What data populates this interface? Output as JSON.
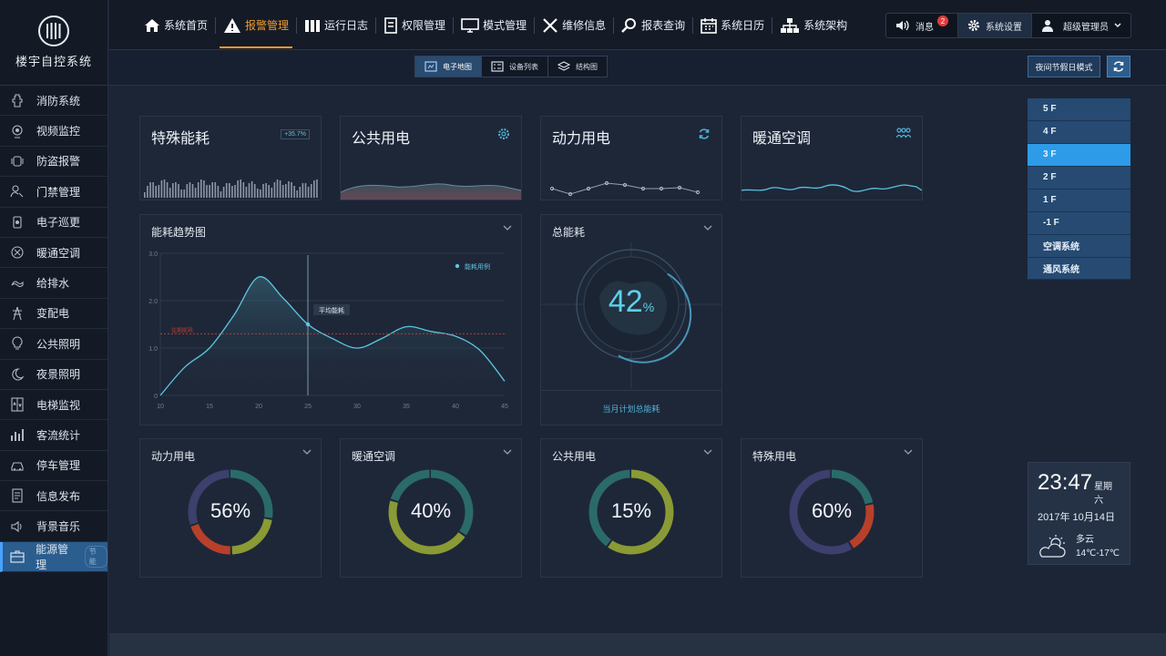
{
  "app": {
    "title": "楼宇自控系统"
  },
  "sidebar": {
    "items": [
      {
        "label": "消防系统",
        "icon": "fire-hydrant-icon"
      },
      {
        "label": "视频监控",
        "icon": "camera-icon"
      },
      {
        "label": "防盗报警",
        "icon": "alarm-icon"
      },
      {
        "label": "门禁管理",
        "icon": "access-control-icon"
      },
      {
        "label": "电子巡更",
        "icon": "patrol-icon"
      },
      {
        "label": "暖通空调",
        "icon": "hvac-icon"
      },
      {
        "label": "给排水",
        "icon": "water-icon"
      },
      {
        "label": "变配电",
        "icon": "power-tower-icon"
      },
      {
        "label": "公共照明",
        "icon": "bulb-icon"
      },
      {
        "label": "夜景照明",
        "icon": "night-light-icon"
      },
      {
        "label": "电梯监视",
        "icon": "elevator-icon"
      },
      {
        "label": "客流统计",
        "icon": "bar-stats-icon"
      },
      {
        "label": "停车管理",
        "icon": "car-icon"
      },
      {
        "label": "信息发布",
        "icon": "document-icon"
      },
      {
        "label": "背景音乐",
        "icon": "speaker-icon"
      },
      {
        "label": "能源管理",
        "icon": "briefcase-icon",
        "badge": "节能",
        "active": true
      }
    ]
  },
  "nav": {
    "items": [
      {
        "label": "系统首页",
        "icon": "home-icon"
      },
      {
        "label": "报警管理",
        "icon": "warning-icon",
        "active": true
      },
      {
        "label": "运行日志",
        "icon": "log-icon"
      },
      {
        "label": "权限管理",
        "icon": "permission-icon"
      },
      {
        "label": "模式管理",
        "icon": "monitor-icon"
      },
      {
        "label": "维修信息",
        "icon": "tools-icon"
      },
      {
        "label": "报表查询",
        "icon": "search-icon"
      },
      {
        "label": "系统日历",
        "icon": "calendar-icon"
      },
      {
        "label": "系统架构",
        "icon": "org-chart-icon"
      }
    ]
  },
  "user": {
    "messages_label": "消息",
    "message_count": "2",
    "settings_label": "系统设置",
    "user_name": "超级管理员"
  },
  "subbar": {
    "views": [
      {
        "label": "电子地图",
        "active": true
      },
      {
        "label": "设备列表"
      },
      {
        "label": "结构图"
      }
    ],
    "holiday_button": "夜间节假日模式"
  },
  "summary_cards": [
    {
      "title": "特殊能耗",
      "tag": "+35.7%",
      "icon": "none"
    },
    {
      "title": "公共用电",
      "icon": "gear-icon"
    },
    {
      "title": "动力用电",
      "icon": "refresh-icon"
    },
    {
      "title": "暖通空调",
      "icon": "people-icon"
    }
  ],
  "trend": {
    "title": "能耗趋势图",
    "legend": "能耗用例",
    "avg_label": "平均能耗",
    "base_label": "往期能耗",
    "y_ticks": [
      "3.0",
      "2.0",
      "1.0",
      "0"
    ],
    "x_ticks": [
      "10",
      "15",
      "20",
      "25",
      "30",
      "35",
      "40",
      "45"
    ]
  },
  "total": {
    "title": "总能耗",
    "value": "42",
    "unit": "%",
    "caption": "当月计划总能耗"
  },
  "rings": [
    {
      "title": "动力用电",
      "value": "56%"
    },
    {
      "title": "暖通空调",
      "value": "40%"
    },
    {
      "title": "公共用电",
      "value": "15%"
    },
    {
      "title": "特殊用电",
      "value": "60%"
    }
  ],
  "floors": [
    "5 F",
    "4 F",
    "3 F",
    "2 F",
    "1 F",
    "-1 F",
    "空调系统",
    "通风系统"
  ],
  "active_floor": "3 F",
  "clock": {
    "time": "23:47",
    "weekday": "星期六",
    "date": "2017年 10月14日",
    "weather": "多云",
    "temp": "14℃-17℃"
  },
  "colors": {
    "accent": "#f19a2a",
    "active_blue": "#2d9be8",
    "teal": "#4fb3d9"
  },
  "chart_data": [
    {
      "type": "area",
      "title": "能耗趋势图",
      "x": [
        10,
        12.5,
        15,
        17.5,
        20,
        22.5,
        25,
        27.5,
        30,
        32.5,
        35,
        37.5,
        40,
        42.5,
        45
      ],
      "series": [
        {
          "name": "能耗用例",
          "values": [
            0,
            0.6,
            1.0,
            1.7,
            2.5,
            2.05,
            1.5,
            1.2,
            1.0,
            1.2,
            1.45,
            1.35,
            1.25,
            0.95,
            0.3
          ]
        }
      ],
      "reference_lines": [
        {
          "label": "往期能耗",
          "y": 1.3
        }
      ],
      "markers": [
        {
          "label": "平均能耗",
          "x": 25
        }
      ],
      "ylim": [
        0,
        3
      ],
      "xlim": [
        10,
        45
      ]
    }
  ]
}
